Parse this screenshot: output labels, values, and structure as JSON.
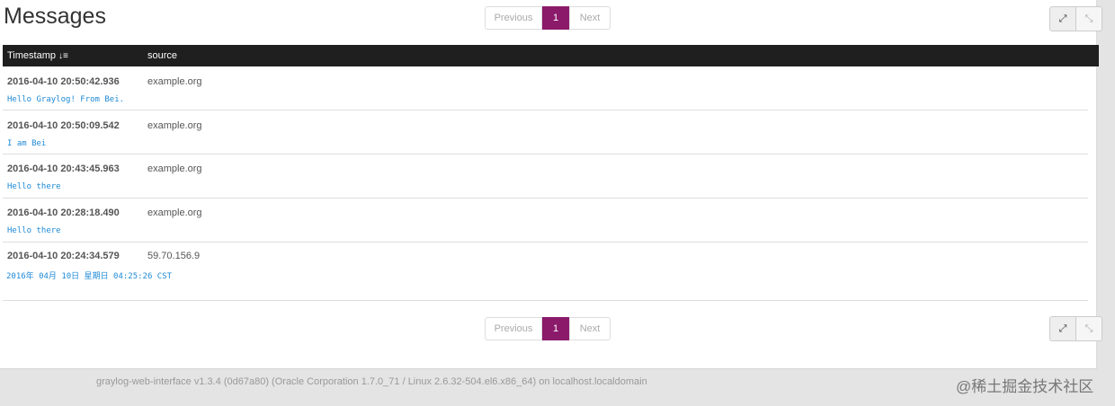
{
  "header": {
    "title": "Messages"
  },
  "pagination": {
    "previous_label": "Previous",
    "current_page": "1",
    "next_label": "Next"
  },
  "toolbar": {
    "expand_icon": "expand-icon",
    "collapse_icon": "collapse-icon"
  },
  "table": {
    "columns": [
      {
        "label": "Timestamp",
        "sort_icon": "↓≡"
      },
      {
        "label": "source"
      }
    ],
    "rows": [
      {
        "timestamp": "2016-04-10 20:50:42.936",
        "source": "example.org",
        "message": "Hello Graylog! From Bei."
      },
      {
        "timestamp": "2016-04-10 20:50:09.542",
        "source": "example.org",
        "message": "I am Bei"
      },
      {
        "timestamp": "2016-04-10 20:43:45.963",
        "source": "example.org",
        "message": "Hello there"
      },
      {
        "timestamp": "2016-04-10 20:28:18.490",
        "source": "example.org",
        "message": "Hello there"
      },
      {
        "timestamp": "2016-04-10 20:24:34.579",
        "source": "59.70.156.9",
        "message": "2016年 04月 10日 星期日 04:25:26 CST"
      }
    ]
  },
  "footer": {
    "text": "graylog-web-interface v1.3.4 (0d67a80) (Oracle Corporation 1.7.0_71 / Linux 2.6.32-504.el6.x86_64) on localhost.localdomain"
  },
  "watermark": {
    "text": "@稀土掘金技术社区"
  },
  "colors": {
    "accent": "#8b1a6b",
    "message": "#1e8ad6",
    "header_bg": "#1f1f1f"
  }
}
